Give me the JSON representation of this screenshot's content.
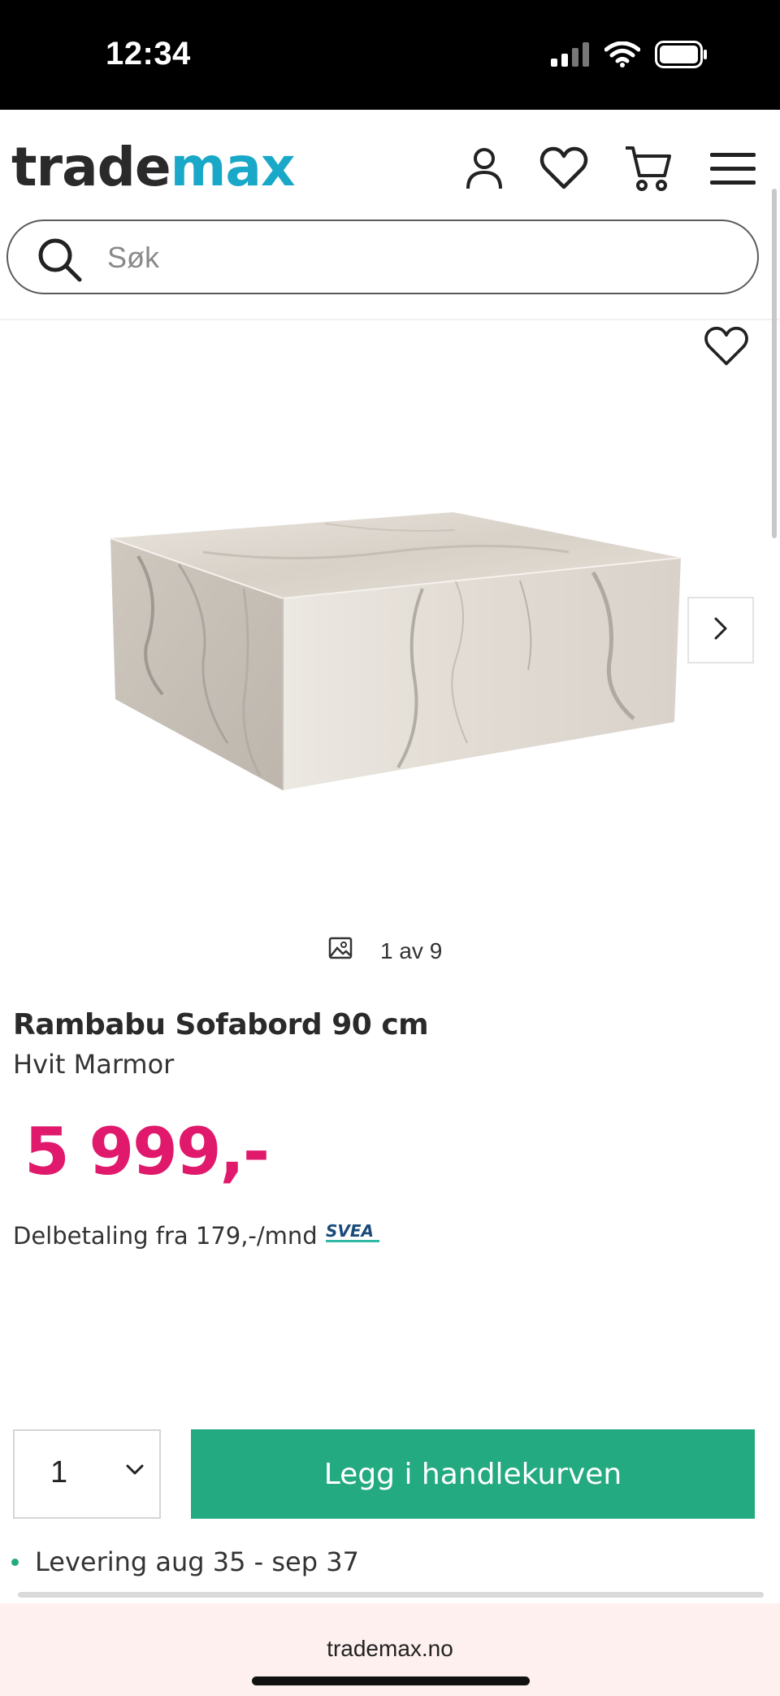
{
  "status_bar": {
    "time": "12:34",
    "icons": [
      "signal-icon",
      "wifi-icon",
      "battery-icon"
    ]
  },
  "header": {
    "logo_part1": "trade",
    "logo_part2": "max",
    "logo_colors": {
      "trade": "#2a2a2a",
      "max": "#1aa8c8"
    },
    "icons": [
      "account-icon",
      "wishlist-icon",
      "cart-icon",
      "menu-icon"
    ]
  },
  "search": {
    "placeholder": "Søk",
    "value": ""
  },
  "gallery": {
    "current": 1,
    "total": 9,
    "counter_text": "1 av 9"
  },
  "product": {
    "title": "Rambabu Sofabord 90 cm",
    "variant": "Hvit Marmor",
    "price": "5 999,-",
    "price_color": "#e0196c",
    "installment_text": "Delbetaling fra 179,-/mnd",
    "installment_provider": "SVEA"
  },
  "purchase": {
    "quantity": "1",
    "add_to_cart_label": "Legg i handlekurven",
    "button_color": "#24aa80",
    "delivery_text": "Levering aug 35 - sep 37"
  },
  "browser": {
    "url": "trademax.no"
  }
}
